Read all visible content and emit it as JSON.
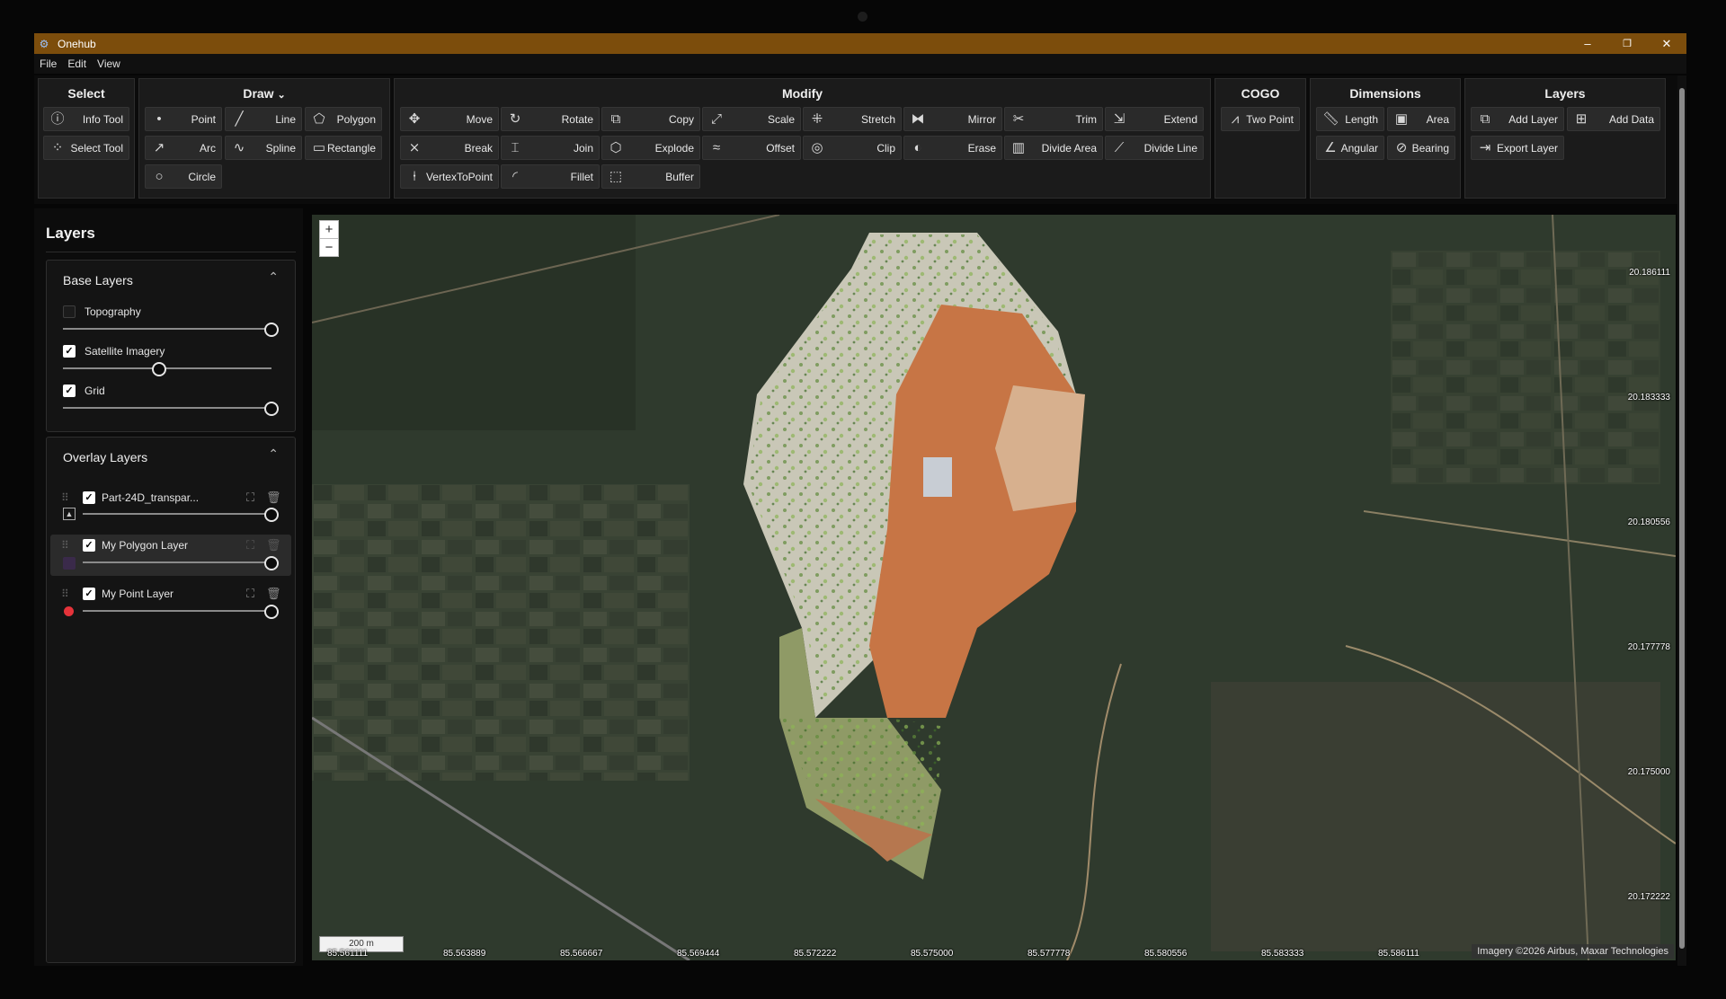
{
  "app": {
    "title": "Onehub",
    "icon": "app-logo-icon"
  },
  "window_controls": {
    "minimize": "–",
    "restore": "❐",
    "close": "✕"
  },
  "menu": [
    "File",
    "Edit",
    "View"
  ],
  "ribbon": {
    "select": {
      "title": "Select",
      "tools": [
        {
          "label": "Info Tool",
          "icon": "info-icon"
        },
        {
          "label": "Select Tool",
          "icon": "cursor-icon"
        }
      ]
    },
    "draw": {
      "title": "Draw",
      "title_chevron": "⌄",
      "tools": [
        {
          "label": "Point",
          "icon": "point-icon"
        },
        {
          "label": "Line",
          "icon": "line-icon"
        },
        {
          "label": "Polygon",
          "icon": "polygon-icon"
        },
        {
          "label": "Arc",
          "icon": "arc-icon"
        },
        {
          "label": "Spline",
          "icon": "spline-icon"
        },
        {
          "label": "Rectangle",
          "icon": "rectangle-icon"
        },
        {
          "label": "Circle",
          "icon": "circle-icon"
        }
      ]
    },
    "modify": {
      "title": "Modify",
      "tools": [
        {
          "label": "Move",
          "icon": "move-icon"
        },
        {
          "label": "Rotate",
          "icon": "rotate-icon"
        },
        {
          "label": "Copy",
          "icon": "copy-icon"
        },
        {
          "label": "Scale",
          "icon": "scale-icon"
        },
        {
          "label": "Stretch",
          "icon": "stretch-icon"
        },
        {
          "label": "Mirror",
          "icon": "mirror-icon"
        },
        {
          "label": "Trim",
          "icon": "scissors-icon"
        },
        {
          "label": "Extend",
          "icon": "extend-icon"
        },
        {
          "label": "Break",
          "icon": "break-icon"
        },
        {
          "label": "Join",
          "icon": "join-icon"
        },
        {
          "label": "Explode",
          "icon": "explode-icon"
        },
        {
          "label": "Offset",
          "icon": "offset-icon"
        },
        {
          "label": "Clip",
          "icon": "clip-icon"
        },
        {
          "label": "Erase",
          "icon": "erase-icon"
        },
        {
          "label": "Divide Area",
          "icon": "divide-area-icon"
        },
        {
          "label": "Divide Line",
          "icon": "divide-line-icon"
        },
        {
          "label": "VertexToPoint",
          "icon": "vertex-icon"
        },
        {
          "label": "Fillet",
          "icon": "fillet-icon"
        },
        {
          "label": "Buffer",
          "icon": "buffer-icon"
        }
      ]
    },
    "cogo": {
      "title": "COGO",
      "tools": [
        {
          "label": "Two Point",
          "icon": "two-point-icon"
        }
      ]
    },
    "dimensions": {
      "title": "Dimensions",
      "tools": [
        {
          "label": "Length",
          "icon": "ruler-icon"
        },
        {
          "label": "Area",
          "icon": "area-icon"
        },
        {
          "label": "Angular",
          "icon": "angle-icon"
        },
        {
          "label": "Bearing",
          "icon": "compass-icon"
        }
      ]
    },
    "layers": {
      "title": "Layers",
      "tools": [
        {
          "label": "Add Layer",
          "icon": "add-layer-icon"
        },
        {
          "label": "Add Data",
          "icon": "add-data-icon"
        },
        {
          "label": "Export Layer",
          "icon": "export-icon"
        }
      ]
    }
  },
  "panel": {
    "title": "Layers",
    "base_layers": {
      "title": "Base Layers",
      "chevron": "⌃",
      "items": [
        {
          "label": "Topography",
          "checked": false,
          "opacity": 1.0
        },
        {
          "label": "Satellite Imagery",
          "checked": true,
          "opacity": 0.46
        },
        {
          "label": "Grid",
          "checked": true,
          "opacity": 1.0
        }
      ]
    },
    "overlay_layers": {
      "title": "Overlay Layers",
      "chevron": "⌃",
      "items": [
        {
          "label": "Part-24D_transpar...",
          "checked": true,
          "opacity": 1.0,
          "type_icon": "image-icon"
        },
        {
          "label": "My Polygon Layer",
          "checked": true,
          "opacity": 1.0,
          "type_icon": "polygon-swatch-icon",
          "selected": true
        },
        {
          "label": "My Point Layer",
          "checked": true,
          "opacity": 1.0,
          "type_icon": "point-swatch-icon",
          "swatch_color": "#e5333a"
        }
      ]
    }
  },
  "map": {
    "zoom_in": "+",
    "zoom_out": "−",
    "scale": "200 m",
    "attribution": "Imagery ©2026 Airbus, Maxar Technologies",
    "lat_labels": [
      "20.186111",
      "20.183333",
      "20.180556",
      "20.177778",
      "20.175000",
      "20.172222"
    ],
    "lon_labels": [
      "85.561111",
      "85.563889",
      "85.566667",
      "85.569444",
      "85.572222",
      "85.575000",
      "85.577778",
      "85.580556",
      "85.583333",
      "85.586111"
    ]
  }
}
